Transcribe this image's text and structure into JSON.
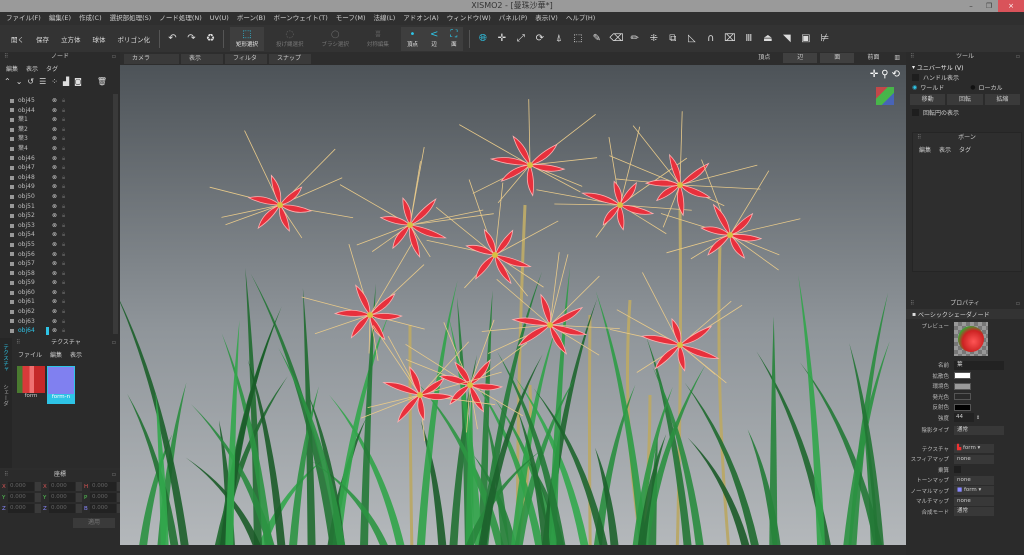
{
  "title": "XISMO2 - [曼珠沙華*]",
  "window_controls": {
    "minimize": "–",
    "restore": "❐",
    "close": "×"
  },
  "menu": [
    "ファイル(F)",
    "編集(E)",
    "作成(C)",
    "選択部処理(S)",
    "ノード処理(N)",
    "UV(U)",
    "ボーン(B)",
    "ボーンウェイト(T)",
    "モーフ(M)",
    "法線(L)",
    "アドオン(A)",
    "ウィンドウ(W)",
    "パネル(P)",
    "表示(V)",
    "ヘルプ(H)"
  ],
  "toolbar": {
    "open": "開く",
    "save": "保存",
    "cube": "立方体",
    "sphere": "球体",
    "polygonize": "ポリゴン化",
    "rect_select": "矩形選択",
    "lasso_select": "投げ縄選択",
    "brush_select": "ブラシ選択",
    "symmetric_edit": "対称編集",
    "vertex": "頂点",
    "edge": "辺",
    "face": "面"
  },
  "node_panel": {
    "title": "ノード",
    "menu": [
      "編集",
      "表示",
      "タグ"
    ],
    "items": [
      "obj45",
      "obj44",
      "葉1",
      "葉2",
      "葉3",
      "葉4",
      "obj46",
      "obj47",
      "obj48",
      "obj49",
      "obj50",
      "obj51",
      "obj52",
      "obj53",
      "obj54",
      "obj55",
      "obj56",
      "obj57",
      "obj58",
      "obj59",
      "obj60",
      "obj61",
      "obj62",
      "obj63",
      "obj64"
    ],
    "selected": "obj64"
  },
  "texture_panel": {
    "title": "テクスチャ",
    "tabs": [
      "テクスチャ",
      "シェーダ"
    ],
    "menu": [
      "ファイル",
      "編集",
      "表示"
    ],
    "textures": [
      "form",
      "form-n"
    ]
  },
  "coord_panel": {
    "title": "座標",
    "rows": [
      [
        "X",
        "0.000",
        "X",
        "0.000",
        "H",
        "0.000"
      ],
      [
        "Y",
        "0.000",
        "Y",
        "0.000",
        "P",
        "0.000"
      ],
      [
        "Z",
        "0.000",
        "Z",
        "0.000",
        "B",
        "0.000"
      ]
    ],
    "apply": "適用"
  },
  "viewport_bar": {
    "camera": "カメラ",
    "display": "表示",
    "filter": "フィルタ",
    "snap": "スナップ",
    "vertex": "頂点",
    "edge": "辺",
    "face": "面",
    "front": "前面"
  },
  "tool_panel": {
    "title": "ツール",
    "mode": "ユニバーサル (V)",
    "show_handle": "ハンドル表示",
    "world": "ワールド",
    "local": "ローカル",
    "move": "移動",
    "rotate": "回転",
    "scale": "拡縮",
    "show_rot_circle": "回転円の表示"
  },
  "bone_panel": {
    "title": "ボーン",
    "menu": [
      "編集",
      "表示",
      "タグ"
    ]
  },
  "property_panel": {
    "title": "プロパティ",
    "node_type": "ベーシックシェーダノード",
    "preview": "プレビュー",
    "name_label": "名前",
    "name": "葉",
    "diffuse": "拡散色",
    "ambient": "環境色",
    "emissive": "発光色",
    "specular": "反射色",
    "intensity_label": "強度",
    "intensity": "44",
    "shading_label": "陰影タイプ",
    "shading": "通常",
    "texture_label": "テクスチャ",
    "texture": "form",
    "sphere_label": "スフィアマップ",
    "sphere": "none",
    "multiply_label": "乗算",
    "tone_label": "トーンマップ",
    "tone": "none",
    "normal_label": "ノーマルマップ",
    "normal": "form",
    "multi_label": "マルチマップ",
    "multi": "none",
    "blend_label": "合成モード",
    "blend": "通常"
  },
  "colors": {
    "accent": "#2ec4e6",
    "diffuse": "#ffffff",
    "ambient": "#9a9a9a",
    "emissive": "#2a2a2a",
    "specular": "#000000",
    "flower": "#e8303c"
  }
}
